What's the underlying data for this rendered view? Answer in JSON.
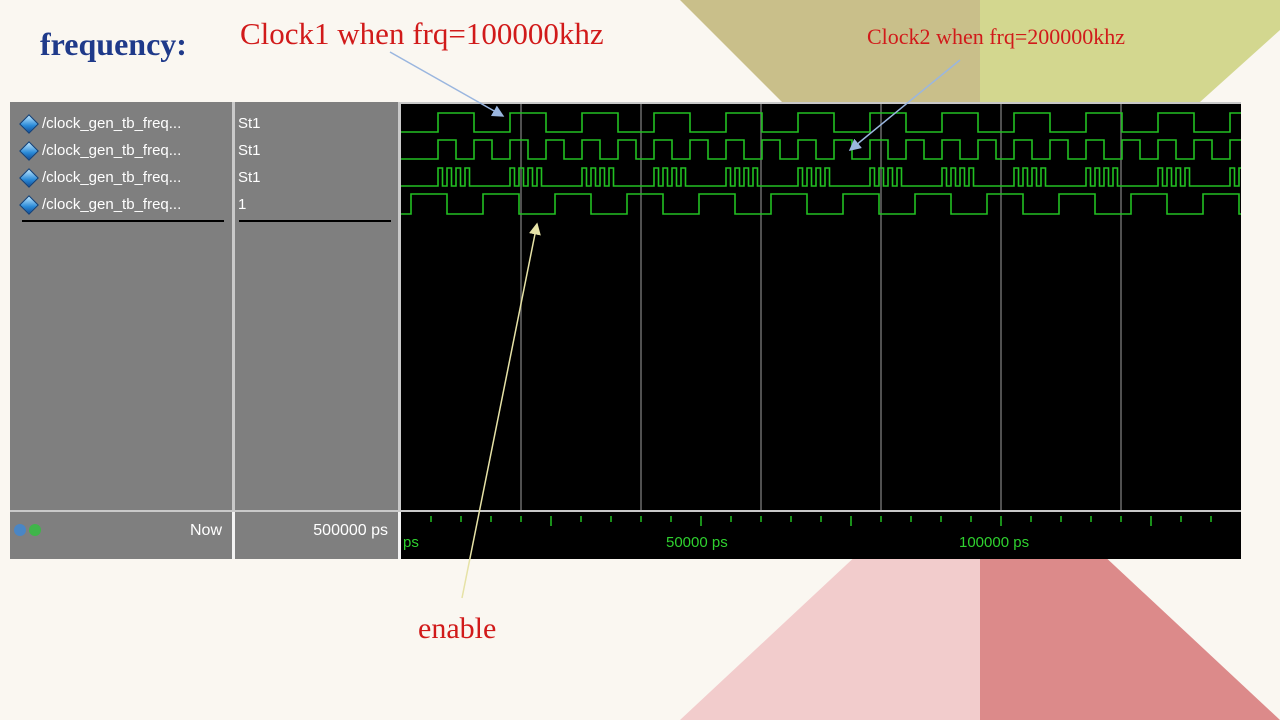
{
  "slide": {
    "title": "frequency:",
    "annotations": {
      "clock1": "Clock1 when frq=100000khz",
      "clock2": "Clock2 when frq=200000khz",
      "enable": "enable"
    },
    "colors": {
      "title": "#1f3a8a",
      "annotation": "#d11a1a",
      "waveform": "#22c022",
      "bg_tan": "#c9bf8a",
      "bg_olive": "#d3d78f",
      "bg_pink": "#f2cccc",
      "bg_rose": "#dc8a8a"
    }
  },
  "wave_window": {
    "signals": [
      {
        "name": "/clock_gen_tb_freq...",
        "value": "St1",
        "icon": "diamond-signal-icon"
      },
      {
        "name": "/clock_gen_tb_freq...",
        "value": "St1",
        "icon": "diamond-signal-icon"
      },
      {
        "name": "/clock_gen_tb_freq...",
        "value": "St1",
        "icon": "diamond-signal-icon"
      },
      {
        "name": "/clock_gen_tb_freq...",
        "value": "1",
        "icon": "diamond-signal-icon"
      }
    ],
    "status": {
      "now_label": "Now",
      "now_value": "500000 ps",
      "timeline_labels": [
        "ps",
        "50000 ps",
        "100000 ps"
      ]
    }
  }
}
